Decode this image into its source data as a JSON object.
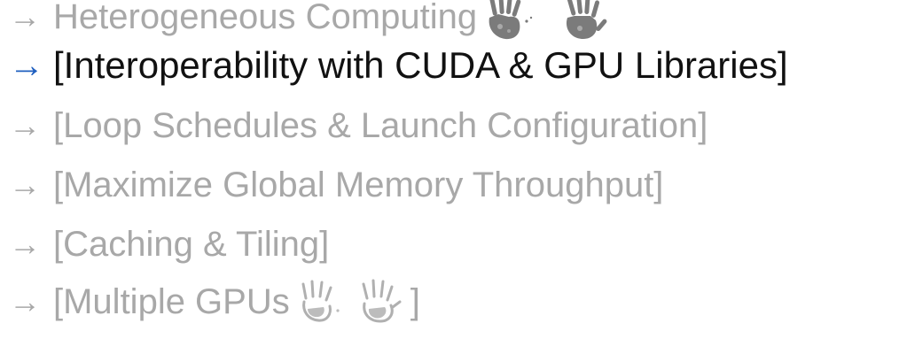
{
  "agenda": {
    "arrow": "→",
    "items": [
      {
        "label": "Heterogeneous Computing",
        "active": false
      },
      {
        "label": "[Interoperability with CUDA & GPU Libraries]",
        "active": true
      },
      {
        "label": "[Loop Schedules & Launch Configuration]",
        "active": false
      },
      {
        "label": "[Maximize Global Memory Throughput]",
        "active": false
      },
      {
        "label": "[Caching & Tiling]",
        "active": false
      },
      {
        "label": "[Multiple GPUs",
        "suffix": "]",
        "active": false
      }
    ]
  },
  "colors": {
    "inactive_text": "#a8a8a8",
    "active_text": "#111111",
    "active_arrow": "#1f5fbf"
  },
  "icons": {
    "hands_heading": "hands-icon",
    "hands_multiple_gpus": "hands-icon"
  }
}
